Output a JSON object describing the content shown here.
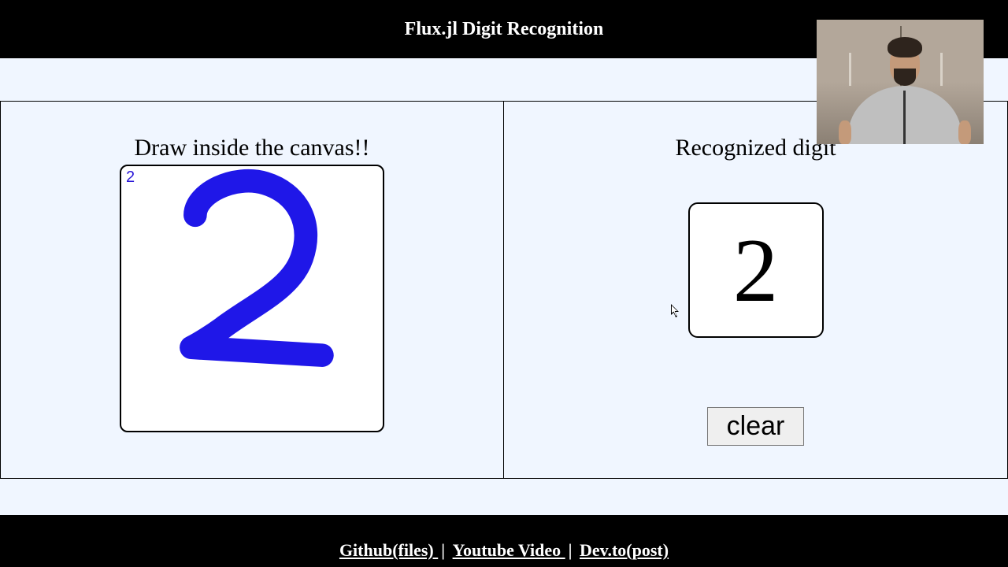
{
  "header": {
    "title": "Flux.jl Digit Recognition"
  },
  "left": {
    "heading": "Draw inside the canvas!!",
    "corner_label": "2"
  },
  "right": {
    "heading": "Recognized digit",
    "predicted_digit": "2",
    "clear_label": "clear"
  },
  "footer": {
    "github": "Github(files) ",
    "youtube": "Youtube Video ",
    "devto": "Dev.to(post)",
    "sep": "| "
  }
}
